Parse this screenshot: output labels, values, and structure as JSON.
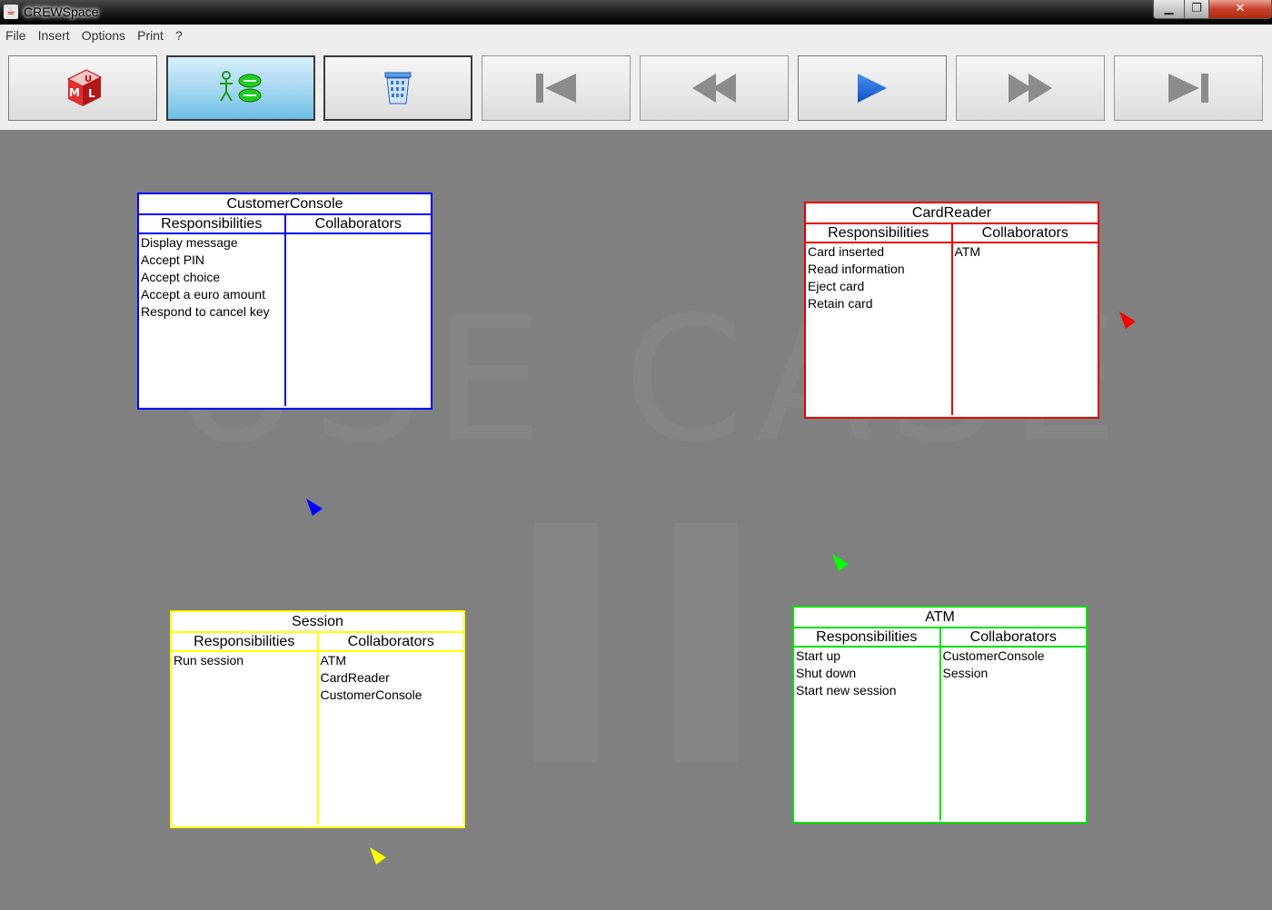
{
  "window": {
    "title": "CREWSpace",
    "min": "▁",
    "max": "❐",
    "close": "✕"
  },
  "menu": [
    "File",
    "Insert",
    "Options",
    "Print",
    "?"
  ],
  "toolbar": {
    "buttons": [
      {
        "name": "uml-button",
        "icon": "uml-icon",
        "state": "normal"
      },
      {
        "name": "crc-button",
        "icon": "crc-card-icon",
        "state": "active"
      },
      {
        "name": "trash-button",
        "icon": "trash-icon",
        "state": "pressed"
      },
      {
        "name": "first-button",
        "icon": "skip-to-start-icon",
        "state": "disabled"
      },
      {
        "name": "rewind-button",
        "icon": "rewind-icon",
        "state": "disabled"
      },
      {
        "name": "play-button",
        "icon": "play-icon",
        "state": "normal"
      },
      {
        "name": "fast-forward-button",
        "icon": "fast-forward-icon",
        "state": "disabled"
      },
      {
        "name": "last-button",
        "icon": "skip-to-end-icon",
        "state": "disabled"
      }
    ]
  },
  "canvas": {
    "watermark": "USE CASE",
    "cards": [
      {
        "title": "CustomerConsole",
        "color": "#0000ff",
        "responsibilities_label": "Responsibilities",
        "collaborators_label": "Collaborators",
        "responsibilities": [
          "Display message",
          "Accept PIN",
          "Accept choice",
          "Accept a euro amount",
          "Respond to cancel key"
        ],
        "collaborators": []
      },
      {
        "title": "CardReader",
        "color": "#e80000",
        "responsibilities_label": "Responsibilities",
        "collaborators_label": "Collaborators",
        "responsibilities": [
          "Card inserted",
          "Read information",
          "Eject card",
          "Retain card"
        ],
        "collaborators": [
          "ATM"
        ]
      },
      {
        "title": "Session",
        "color": "#ffff00",
        "responsibilities_label": "Responsibilities",
        "collaborators_label": "Collaborators",
        "responsibilities": [
          "Run session"
        ],
        "collaborators": [
          "ATM",
          "CardReader",
          "CustomerConsole"
        ]
      },
      {
        "title": "ATM",
        "color": "#00e000",
        "responsibilities_label": "Responsibilities",
        "collaborators_label": "Collaborators",
        "responsibilities": [
          "Start up",
          "Shut down",
          "Start new session"
        ],
        "collaborators": [
          "CustomerConsole",
          "Session"
        ]
      }
    ],
    "cursors": [
      {
        "name": "blue-user-cursor-icon",
        "color": "#0000ff"
      },
      {
        "name": "red-user-cursor-icon",
        "color": "#ff0000"
      },
      {
        "name": "green-user-cursor-icon",
        "color": "#00ff00"
      },
      {
        "name": "yellow-user-cursor-icon",
        "color": "#ffff00"
      }
    ]
  }
}
